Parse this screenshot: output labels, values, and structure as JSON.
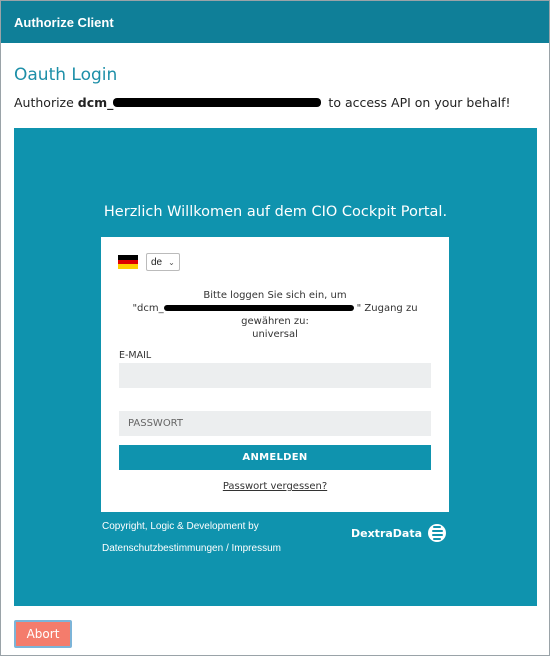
{
  "window": {
    "title": "Authorize Client"
  },
  "oauth": {
    "heading": "Oauth Login",
    "authorize_prefix": "Authorize",
    "client_name": "dcm_",
    "authorize_suffix": "to access API on your behalf!"
  },
  "portal": {
    "welcome": "Herzlich Willkomen auf dem CIO Cockpit Portal.",
    "language": {
      "selected": "de"
    },
    "prompt": {
      "line1": "Bitte loggen Sie sich ein, um",
      "client_prefix": "\"dcm_",
      "client_suffix": "\" Zugang zu",
      "line3": "gewähren zu:",
      "line4": "universal"
    },
    "email_label": "E-MAIL",
    "email_value": "",
    "password_placeholder": "PASSWORT",
    "login_label": "ANMELDEN",
    "forgot_label": "Passwort vergessen?",
    "copyright": "Copyright, Logic & Development by",
    "privacy_link": "Datenschutzbestimmungen / Impressum",
    "logo_text": "DextraData"
  },
  "actions": {
    "abort_label": "Abort"
  },
  "colors": {
    "titlebar": "#0f7f98",
    "portal_bg": "#0f93ae",
    "abort_bg": "#f47c6c",
    "heading": "#1d8fa8"
  },
  "icons": {
    "flag": "germany-flag-icon",
    "select": "chevron-down-icon",
    "logo": "dextradata-logo-icon"
  }
}
